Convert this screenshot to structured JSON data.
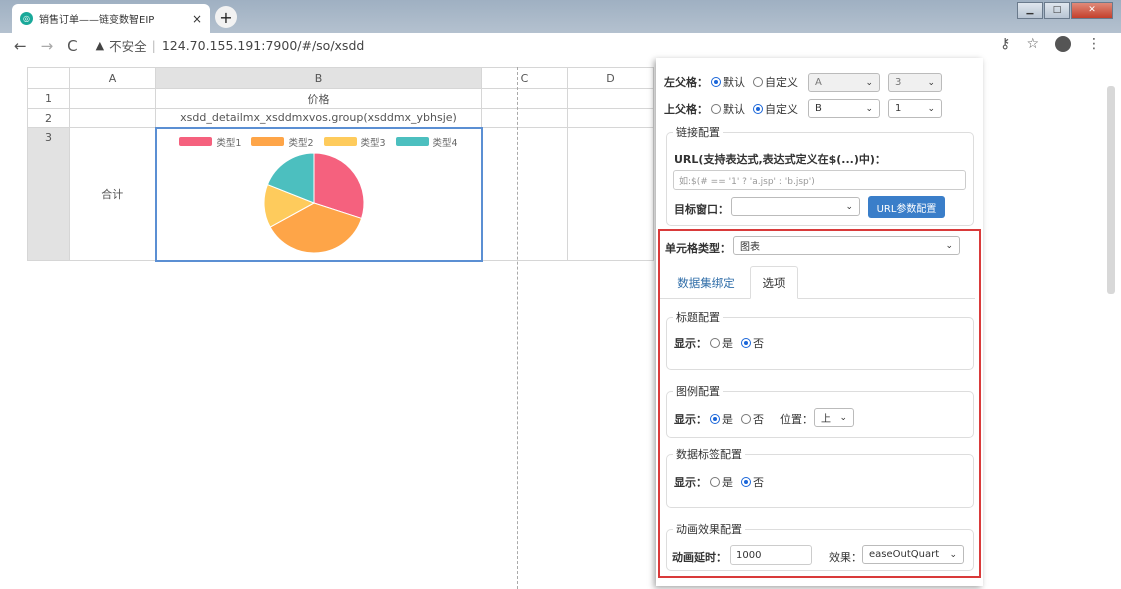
{
  "browser": {
    "tab_title": "销售订单——链变数智EIP",
    "tab_close": "×",
    "new_tab": "+",
    "not_secure": "不安全",
    "url": "124.70.155.191:7900/#/so/xsdd"
  },
  "sheet": {
    "columns": [
      "A",
      "B",
      "C",
      "D"
    ],
    "rows": [
      "1",
      "2",
      "3"
    ],
    "b1": "价格",
    "b2": "xsdd_detailmx_xsddmxvos.group(xsddmx_ybhsje)",
    "a3": "合计"
  },
  "chart_data": {
    "type": "pie",
    "legend": "top",
    "series": [
      {
        "name": "类型1",
        "color": "#f5617e",
        "value": 30
      },
      {
        "name": "类型2",
        "color": "#fea548",
        "value": 37
      },
      {
        "name": "类型3",
        "color": "#fecb5c",
        "value": 14
      },
      {
        "name": "类型4",
        "color": "#4cbfbf",
        "value": 19
      }
    ]
  },
  "panel": {
    "left_parent_label": "左父格：",
    "top_parent_label": "上父格：",
    "opt_default": "默认",
    "opt_custom": "自定义",
    "left_parent": {
      "selected": "default",
      "col": "A",
      "row": "3"
    },
    "top_parent": {
      "selected": "custom",
      "col": "B",
      "row": "1"
    },
    "link_config": {
      "legend": "链接配置",
      "url_label": "URL(支持表达式,表达式定义在$(...)中)：",
      "url_placeholder": "如:$(# == '1' ? 'a.jsp' : 'b.jsp')",
      "target_label": "目标窗口：",
      "target_value": "",
      "param_button": "URL参数配置"
    },
    "cell_type_label": "单元格类型：",
    "cell_type": "图表",
    "tabs": [
      "数据集绑定",
      "选项"
    ],
    "title_config": {
      "legend": "标题配置",
      "show_label": "显示：",
      "yes": "是",
      "no": "否",
      "selected": "no"
    },
    "legend_config": {
      "legend": "图例配置",
      "show_label": "显示：",
      "yes": "是",
      "no": "否",
      "selected": "yes",
      "position_label": "位置：",
      "position": "上"
    },
    "data_label_config": {
      "legend": "数据标签配置",
      "show_label": "显示：",
      "yes": "是",
      "no": "否",
      "selected": "no"
    },
    "animation_config": {
      "legend": "动画效果配置",
      "delay_label": "动画延时：",
      "delay": "1000",
      "effect_label": "效果：",
      "effect": "easeOutQuart"
    }
  }
}
